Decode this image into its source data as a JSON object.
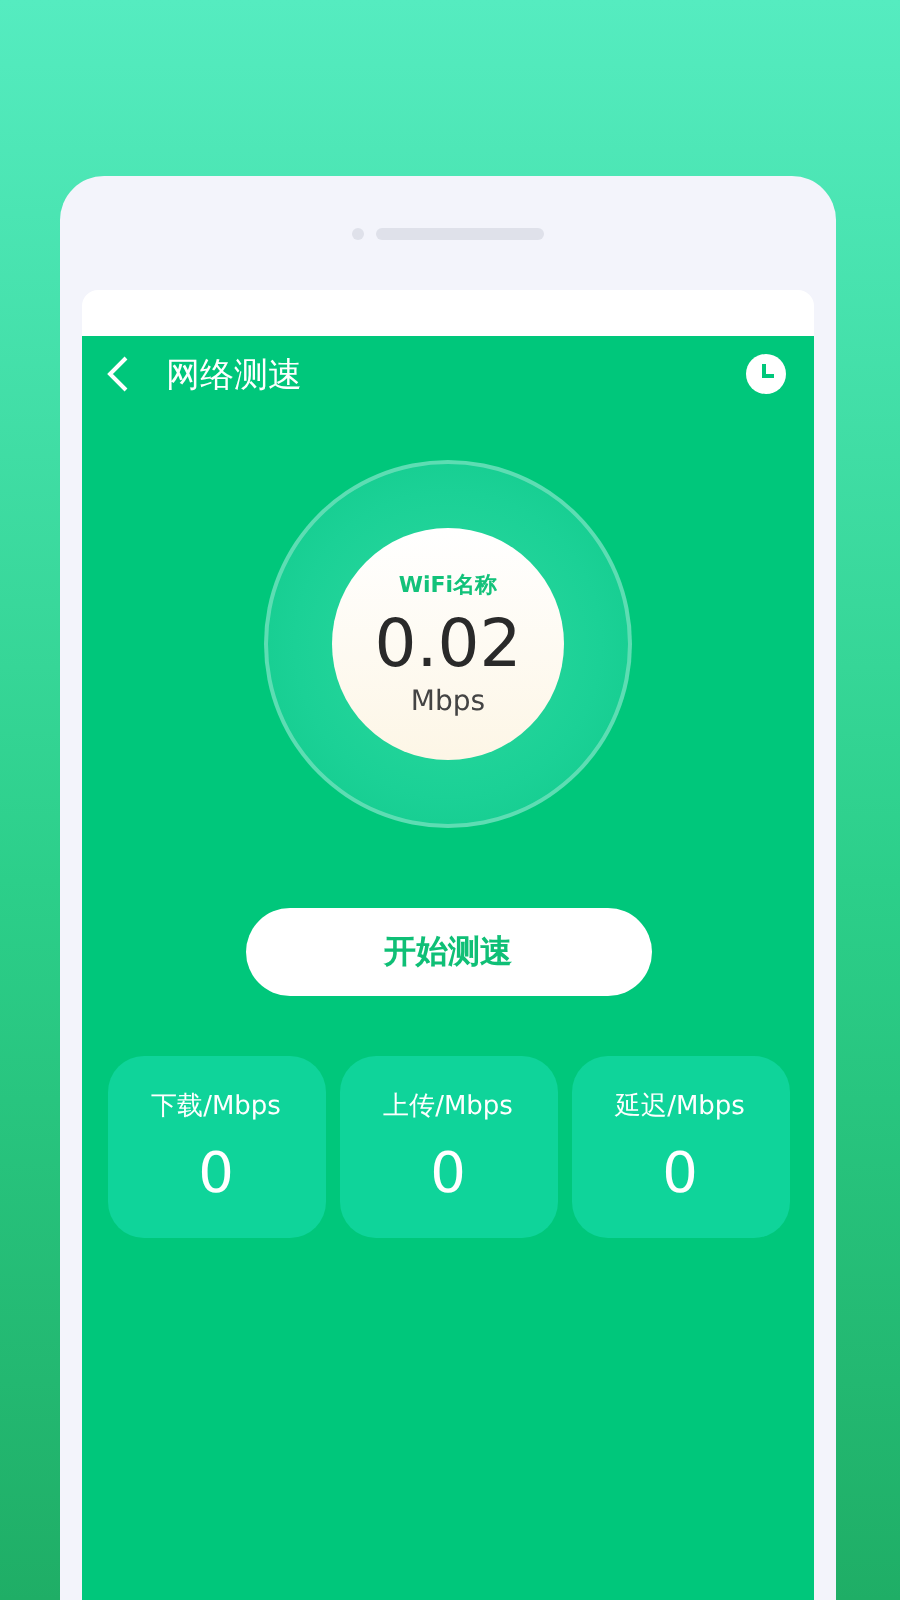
{
  "header": {
    "title": "网络测速"
  },
  "gauge": {
    "label": "WiFi名称",
    "value": "0.02",
    "unit": "Mbps"
  },
  "start_button": "开始测速",
  "stats": [
    {
      "label": "下载/Mbps",
      "value": "0"
    },
    {
      "label": "上传/Mbps",
      "value": "0"
    },
    {
      "label": "延迟/Mbps",
      "value": "0"
    }
  ]
}
